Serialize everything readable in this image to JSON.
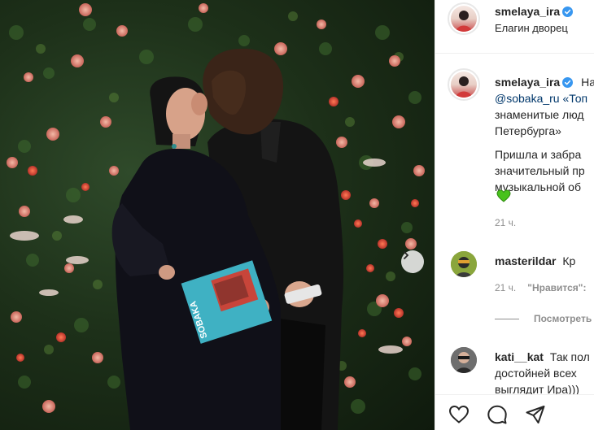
{
  "post": {
    "username": "smelaya_ira",
    "location": "Елагин дворец"
  },
  "photo": {
    "book_title": "SOBAKA"
  },
  "caption": {
    "username": "smelaya_ira",
    "line1": "На",
    "line2": "@sobaka_ru «Топ",
    "line3": "знаменитые люд",
    "line4": "Петербурга»",
    "line5": "Пришла и забра",
    "line6": "значительный пр",
    "line7": "музыкальной об",
    "time": "21 ч."
  },
  "comments": [
    {
      "username": "masterildar",
      "text": "Кр",
      "time": "21 ч.",
      "likes_label": "\"Нравится\":"
    },
    {
      "username": "kati__kat",
      "line1": "Так пол",
      "line2": "достойней всех",
      "line3": "выглядит Ира)))"
    }
  ],
  "replies_label": "Посмотреть",
  "icons": {
    "verified": "verified-badge-icon",
    "green_heart": "green-heart-emoji",
    "next": "chevron-right-icon",
    "like": "heart-icon",
    "comment": "comment-icon",
    "share": "paper-plane-icon"
  },
  "colors": {
    "verified_blue": "#3897f0",
    "mention": "#00376b",
    "muted": "#8e8e8e",
    "heart_green": "#48c21c"
  }
}
